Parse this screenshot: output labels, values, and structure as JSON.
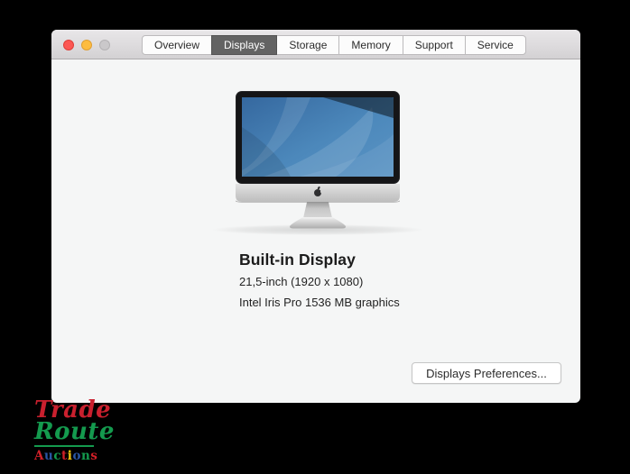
{
  "window": {
    "controls": [
      {
        "name": "close",
        "color": "#fc5753"
      },
      {
        "name": "minimize",
        "color": "#fdbc40"
      },
      {
        "name": "zoom",
        "color": "#cac8ca"
      }
    ],
    "tabs": [
      {
        "label": "Overview",
        "selected": false
      },
      {
        "label": "Displays",
        "selected": true
      },
      {
        "label": "Storage",
        "selected": false
      },
      {
        "label": "Memory",
        "selected": false
      },
      {
        "label": "Support",
        "selected": false
      },
      {
        "label": "Service",
        "selected": false
      }
    ],
    "selected_tab_color": "#636363"
  },
  "display_info": {
    "title": "Built-in Display",
    "size_resolution": "21,5-inch (1920 x 1080)",
    "graphics": "Intel Iris Pro 1536 MB graphics",
    "preferences_button": "Displays Preferences..."
  },
  "imac_illustration": {
    "screen_color_top": "#35689f",
    "screen_color_bottom": "#5a94c4",
    "bezel_color": "#151517",
    "chin_color": "#d2d2d2"
  },
  "watermark": {
    "line1": "Trade",
    "line2": "Route",
    "line1_color": "#c9202e",
    "line2_color": "#149a4e",
    "divider_color": "#149a4e",
    "auctions_letters": [
      {
        "ch": "A",
        "color": "#d02028"
      },
      {
        "ch": "u",
        "color": "#2a56a4"
      },
      {
        "ch": "c",
        "color": "#149a4e"
      },
      {
        "ch": "t",
        "color": "#d02028"
      },
      {
        "ch": "i",
        "color": "#f4c50e"
      },
      {
        "ch": "o",
        "color": "#2a56a4"
      },
      {
        "ch": "n",
        "color": "#149a4e"
      },
      {
        "ch": "s",
        "color": "#d02028"
      }
    ]
  }
}
